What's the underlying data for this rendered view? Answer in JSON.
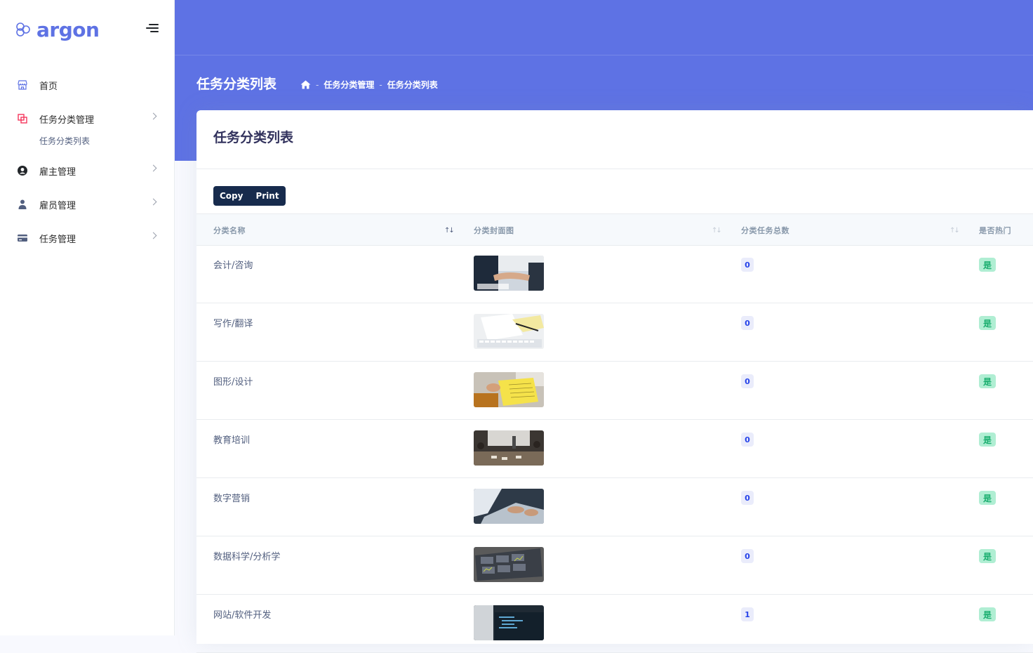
{
  "brand": {
    "name": "argon"
  },
  "sidebar": {
    "items": [
      {
        "label": "首页",
        "icon": "shop-icon"
      },
      {
        "label": "任务分类管理",
        "icon": "layers-icon",
        "children": [
          "任务分类列表"
        ]
      },
      {
        "label": "雇主管理",
        "icon": "user-circle-icon"
      },
      {
        "label": "雇员管理",
        "icon": "user-icon"
      },
      {
        "label": "任务管理",
        "icon": "credit-card-icon"
      }
    ]
  },
  "header": {
    "title": "任务分类列表",
    "breadcrumb": [
      "任务分类管理",
      "任务分类列表"
    ]
  },
  "card": {
    "title": "任务分类列表",
    "buttons": {
      "copy": "Copy",
      "print": "Print"
    }
  },
  "table": {
    "columns": [
      "分类名称",
      "分类封面图",
      "分类任务总数",
      "是否热门"
    ],
    "rows": [
      {
        "name": "会计/咨询",
        "count": "0",
        "hot": "是",
        "image": "handshake-photo"
      },
      {
        "name": "写作/翻译",
        "count": "0",
        "hot": "是",
        "image": "keyboard-notes-photo"
      },
      {
        "name": "图形/设计",
        "count": "0",
        "hot": "是",
        "image": "yellow-book-photo"
      },
      {
        "name": "教育培训",
        "count": "0",
        "hot": "是",
        "image": "classroom-photo"
      },
      {
        "name": "数字营销",
        "count": "0",
        "hot": "是",
        "image": "laptop-typing-photo"
      },
      {
        "name": "数据科学/分析学",
        "count": "0",
        "hot": "是",
        "image": "dashboard-screen-photo"
      },
      {
        "name": "网站/软件开发",
        "count": "1",
        "hot": "是",
        "image": "code-screen-photo"
      }
    ]
  },
  "colors": {
    "primary": "#5e72e4",
    "dark": "#172b4d",
    "success_bg": "#b0eed3",
    "success_text": "#1aae6f",
    "count_bg": "#eaecfb",
    "count_text": "#2643e9",
    "layers_icon": "#f5365c"
  }
}
